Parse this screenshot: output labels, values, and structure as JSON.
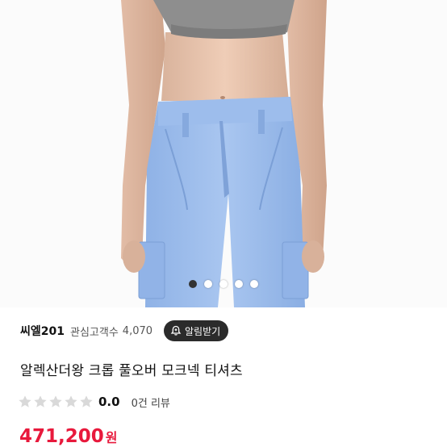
{
  "product_image": {
    "slides_total": 5,
    "active_slide_index": 0
  },
  "seller": {
    "name": "씨엘201",
    "followers_label": "관심고객수",
    "followers_count": "4,070",
    "alarm_button_label": "알림받기"
  },
  "product": {
    "title": "알렉산더왕 크롭 풀오버 모크넥 티셔츠",
    "rating": "0.0",
    "rating_stars_filled": 0,
    "review_count_label": "0건 리뷰",
    "price": "471,200",
    "currency": "원"
  },
  "colors": {
    "price": "#e8193c",
    "alarm_button_bg": "#2b2b2b",
    "star_empty": "#d9d9d9",
    "dot_active": "#333333"
  }
}
